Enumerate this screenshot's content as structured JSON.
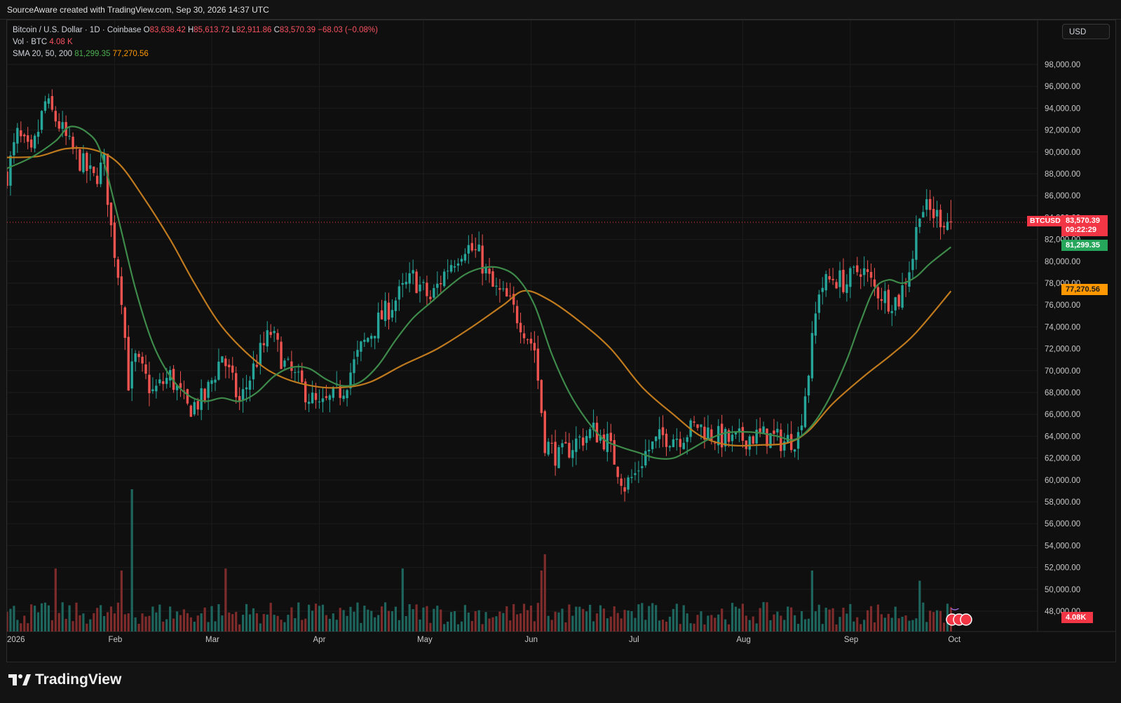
{
  "header": {
    "credit": "SourceAware created with TradingView.com, Sep 30, 2026 14:37 UTC"
  },
  "legend": {
    "symbol": "Bitcoin / U.S. Dollar · 1D · Coinbase",
    "o_label": "O",
    "o_value": "83,638.42",
    "h_label": "H",
    "h_value": "85,613.72",
    "l_label": "L",
    "l_value": "82,911.86",
    "c_label": "C",
    "c_value": "83,570.39",
    "change": "−68.03 (−0.08%)",
    "vol_label": "Vol · BTC",
    "vol_value": "4.08 K",
    "sma_label": "SMA 20, 50, 200",
    "sma_fast_value": "81,299.35",
    "sma_slow_value": "77,270.56"
  },
  "currency_button": "USD",
  "tags": {
    "symbol": "BTCUSD",
    "last_price": "83,570.39",
    "countdown": "09:22:29",
    "sma_fast": "81,299.35",
    "sma_slow": "77,270.56",
    "volume": "4.08K"
  },
  "brand": "TradingView",
  "colors": {
    "up": "#26a69a",
    "down": "#ef5350",
    "sma_fast": "#3d8a4a",
    "sma_slow": "#c07a1e",
    "last_price": "#f23645",
    "background": "#0f0f0f"
  },
  "chart_data": {
    "type": "candlestick",
    "ylim": [
      48000,
      98000
    ],
    "y_ticks": [
      "98,000.00",
      "96,000.00",
      "94,000.00",
      "92,000.00",
      "90,000.00",
      "88,000.00",
      "86,000.00",
      "84,000.00",
      "82,000.00",
      "80,000.00",
      "78,000.00",
      "76,000.00",
      "74,000.00",
      "72,000.00",
      "70,000.00",
      "68,000.00",
      "66,000.00",
      "64,000.00",
      "62,000.00",
      "60,000.00",
      "58,000.00",
      "56,000.00",
      "54,000.00",
      "52,000.00",
      "50,000.00",
      "48,000.00"
    ],
    "x_ticks": [
      "2026",
      "Feb",
      "Mar",
      "Apr",
      "May",
      "Jun",
      "Jul",
      "Aug",
      "Sep",
      "Oct"
    ],
    "price_path": [
      [
        "2026-01-01",
        88000
      ],
      [
        "2026-01-04",
        91500
      ],
      [
        "2026-01-08",
        89500
      ],
      [
        "2026-01-12",
        94500
      ],
      [
        "2026-01-16",
        92500
      ],
      [
        "2026-01-19",
        90500
      ],
      [
        "2026-01-26",
        87500
      ],
      [
        "2026-01-29",
        89000
      ],
      [
        "2026-01-31",
        83000
      ],
      [
        "2026-02-03",
        77000
      ],
      [
        "2026-02-05",
        69000
      ],
      [
        "2026-02-07",
        71000
      ],
      [
        "2026-02-12",
        68000
      ],
      [
        "2026-02-17",
        69500
      ],
      [
        "2026-02-22",
        66500
      ],
      [
        "2026-02-27",
        67500
      ],
      [
        "2026-03-04",
        71500
      ],
      [
        "2026-03-09",
        67000
      ],
      [
        "2026-03-14",
        71000
      ],
      [
        "2026-03-18",
        73500
      ],
      [
        "2026-03-22",
        70500
      ],
      [
        "2026-03-27",
        68500
      ],
      [
        "2026-04-01",
        66500
      ],
      [
        "2026-04-05",
        67500
      ],
      [
        "2026-04-08",
        68500
      ],
      [
        "2026-04-13",
        72000
      ],
      [
        "2026-04-18",
        74500
      ],
      [
        "2026-04-23",
        76500
      ],
      [
        "2026-04-28",
        78500
      ],
      [
        "2026-05-03",
        76500
      ],
      [
        "2026-05-08",
        79500
      ],
      [
        "2026-05-13",
        81500
      ],
      [
        "2026-05-17",
        80500
      ],
      [
        "2026-05-21",
        77500
      ],
      [
        "2026-05-25",
        76500
      ],
      [
        "2026-05-29",
        74500
      ],
      [
        "2026-06-02",
        72000
      ],
      [
        "2026-06-05",
        63500
      ],
      [
        "2026-06-09",
        62000
      ],
      [
        "2026-06-14",
        63500
      ],
      [
        "2026-06-19",
        64500
      ],
      [
        "2026-06-23",
        63500
      ],
      [
        "2026-06-28",
        59500
      ],
      [
        "2026-07-01",
        60500
      ],
      [
        "2026-07-04",
        62500
      ],
      [
        "2026-07-09",
        64000
      ],
      [
        "2026-07-14",
        64000
      ],
      [
        "2026-07-19",
        65000
      ],
      [
        "2026-07-24",
        64000
      ],
      [
        "2026-07-29",
        63500
      ],
      [
        "2026-08-03",
        64000
      ],
      [
        "2026-08-08",
        64000
      ],
      [
        "2026-08-13",
        63500
      ],
      [
        "2026-08-17",
        64000
      ],
      [
        "2026-08-20",
        70000
      ],
      [
        "2026-08-23",
        77500
      ],
      [
        "2026-08-27",
        78500
      ],
      [
        "2026-08-31",
        78000
      ],
      [
        "2026-09-04",
        79500
      ],
      [
        "2026-09-08",
        77500
      ],
      [
        "2026-09-12",
        76500
      ],
      [
        "2026-09-15",
        76500
      ],
      [
        "2026-09-17",
        78500
      ],
      [
        "2026-09-19",
        80500
      ],
      [
        "2026-09-21",
        85000
      ],
      [
        "2026-09-24",
        84500
      ],
      [
        "2026-09-27",
        84000
      ],
      [
        "2026-09-30",
        83570.39
      ]
    ],
    "sma_fast": {
      "name": "SMA 20",
      "points": [
        [
          "2026-01-01",
          88500
        ],
        [
          "2026-01-08",
          89500
        ],
        [
          "2026-01-15",
          91000
        ],
        [
          "2026-01-19",
          92300
        ],
        [
          "2026-01-24",
          91800
        ],
        [
          "2026-01-28",
          90000
        ],
        [
          "2026-02-02",
          84000
        ],
        [
          "2026-02-07",
          77500
        ],
        [
          "2026-02-12",
          72500
        ],
        [
          "2026-02-17",
          69500
        ],
        [
          "2026-02-22",
          67800
        ],
        [
          "2026-02-27",
          67200
        ],
        [
          "2026-03-04",
          67500
        ],
        [
          "2026-03-09",
          67200
        ],
        [
          "2026-03-14",
          68000
        ],
        [
          "2026-03-19",
          69500
        ],
        [
          "2026-03-24",
          70300
        ],
        [
          "2026-03-29",
          70200
        ],
        [
          "2026-04-03",
          69200
        ],
        [
          "2026-04-08",
          68600
        ],
        [
          "2026-04-13",
          69000
        ],
        [
          "2026-04-18",
          70500
        ],
        [
          "2026-04-23",
          72800
        ],
        [
          "2026-04-28",
          74800
        ],
        [
          "2026-05-03",
          76200
        ],
        [
          "2026-05-08",
          77600
        ],
        [
          "2026-05-13",
          78800
        ],
        [
          "2026-05-18",
          79400
        ],
        [
          "2026-05-23",
          79400
        ],
        [
          "2026-05-28",
          78500
        ],
        [
          "2026-06-02",
          76000
        ],
        [
          "2026-06-07",
          71500
        ],
        [
          "2026-06-12",
          68000
        ],
        [
          "2026-06-17",
          65500
        ],
        [
          "2026-06-22",
          63700
        ],
        [
          "2026-06-27",
          63000
        ],
        [
          "2026-07-02",
          62500
        ],
        [
          "2026-07-07",
          62000
        ],
        [
          "2026-07-12",
          62000
        ],
        [
          "2026-07-17",
          62800
        ],
        [
          "2026-07-22",
          63700
        ],
        [
          "2026-07-27",
          64300
        ],
        [
          "2026-08-01",
          64400
        ],
        [
          "2026-08-06",
          64300
        ],
        [
          "2026-08-11",
          64000
        ],
        [
          "2026-08-16",
          63700
        ],
        [
          "2026-08-21",
          65000
        ],
        [
          "2026-08-26",
          67500
        ],
        [
          "2026-08-31",
          71000
        ],
        [
          "2026-09-04",
          74500
        ],
        [
          "2026-09-08",
          77500
        ],
        [
          "2026-09-12",
          78300
        ],
        [
          "2026-09-16",
          78000
        ],
        [
          "2026-09-20",
          78600
        ],
        [
          "2026-09-24",
          79800
        ],
        [
          "2026-09-30",
          81299.35
        ]
      ]
    },
    "sma_slow": {
      "name": "SMA 200",
      "points": [
        [
          "2026-01-01",
          89500
        ],
        [
          "2026-01-10",
          89600
        ],
        [
          "2026-01-18",
          90300
        ],
        [
          "2026-01-26",
          90200
        ],
        [
          "2026-02-02",
          89000
        ],
        [
          "2026-02-09",
          86000
        ],
        [
          "2026-02-17",
          82000
        ],
        [
          "2026-02-24",
          78000
        ],
        [
          "2026-03-04",
          74000
        ],
        [
          "2026-03-14",
          70800
        ],
        [
          "2026-03-22",
          69300
        ],
        [
          "2026-04-01",
          68500
        ],
        [
          "2026-04-09",
          68500
        ],
        [
          "2026-04-16",
          69000
        ],
        [
          "2026-04-25",
          70500
        ],
        [
          "2026-05-05",
          72000
        ],
        [
          "2026-05-15",
          74000
        ],
        [
          "2026-05-24",
          76000
        ],
        [
          "2026-05-30",
          77300
        ],
        [
          "2026-06-06",
          76500
        ],
        [
          "2026-06-15",
          74500
        ],
        [
          "2026-06-24",
          72000
        ],
        [
          "2026-07-03",
          68500
        ],
        [
          "2026-07-12",
          66000
        ],
        [
          "2026-07-20",
          64000
        ],
        [
          "2026-07-28",
          63200
        ],
        [
          "2026-08-06",
          63200
        ],
        [
          "2026-08-14",
          63400
        ],
        [
          "2026-08-20",
          64500
        ],
        [
          "2026-08-27",
          67000
        ],
        [
          "2026-09-05",
          69500
        ],
        [
          "2026-09-13",
          71500
        ],
        [
          "2026-09-20",
          73500
        ],
        [
          "2026-09-30",
          77270.56
        ]
      ]
    },
    "volume_peaks": [
      [
        "2026-02-06",
        70
      ],
      [
        "2026-02-03",
        30
      ],
      [
        "2026-06-05",
        38
      ],
      [
        "2026-06-04",
        30
      ],
      [
        "2026-01-15",
        31
      ],
      [
        "2026-03-05",
        31
      ],
      [
        "2026-04-25",
        31
      ],
      [
        "2026-08-21",
        30
      ],
      [
        "2026-09-21",
        25
      ]
    ]
  }
}
